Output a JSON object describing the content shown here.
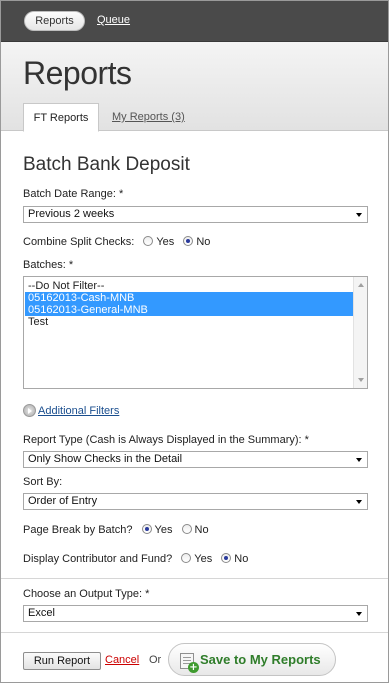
{
  "nav": {
    "reports_label": "Reports",
    "queue_label": "Queue"
  },
  "header": {
    "title": "Reports",
    "tabs": [
      {
        "label": "FT Reports",
        "active": true
      },
      {
        "label": "My Reports (3)",
        "active": false
      }
    ]
  },
  "form": {
    "section_title": "Batch Bank Deposit",
    "batch_date_range": {
      "label": "Batch Date Range: *",
      "value": "Previous 2 weeks"
    },
    "combine_split_checks": {
      "label": "Combine Split Checks:",
      "yes": "Yes",
      "no": "No",
      "selected": "No"
    },
    "batches": {
      "label": "Batches: *",
      "options": [
        {
          "text": "--Do Not Filter--",
          "selected": false
        },
        {
          "text": "05162013-Cash-MNB",
          "selected": true
        },
        {
          "text": "05162013-General-MNB",
          "selected": true
        },
        {
          "text": "Test",
          "selected": false
        }
      ]
    },
    "additional_filters_label": "Additional Filters",
    "report_type": {
      "label": "Report Type (Cash is Always Displayed in the Summary): *",
      "value": "Only Show Checks in the Detail"
    },
    "sort_by": {
      "label": "Sort By:",
      "value": "Order of Entry"
    },
    "page_break": {
      "label": "Page Break by Batch?",
      "yes": "Yes",
      "no": "No",
      "selected": "Yes"
    },
    "display_contributor": {
      "label": "Display Contributor and Fund?",
      "yes": "Yes",
      "no": "No",
      "selected": "No"
    },
    "output_type": {
      "label": "Choose an Output Type: *",
      "value": "Excel"
    }
  },
  "actions": {
    "run_label": "Run Report",
    "cancel_label": "Cancel",
    "or_label": "Or",
    "save_label": "Save to My Reports"
  },
  "colors": {
    "topbar": "#4a4a4a",
    "selection": "#3399ff",
    "cancel": "#cc0000",
    "save_text": "#2f7d2a"
  }
}
